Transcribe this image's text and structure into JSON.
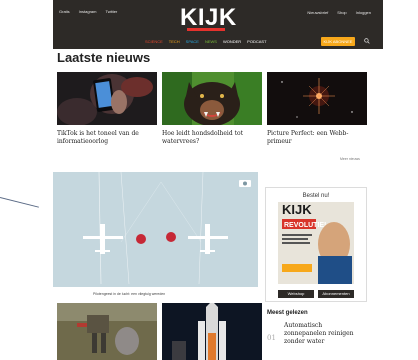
{
  "header": {
    "top_links": [
      "Gratis",
      "Instagram",
      "Twitter"
    ],
    "logo": "KIJK",
    "right_links": [
      "Nieuwsbrief",
      "Shop",
      "Inloggen"
    ],
    "nav": [
      {
        "label": "SCIENCE",
        "color": "#e4472b"
      },
      {
        "label": "TECH",
        "color": "#f7a81b"
      },
      {
        "label": "SPACE",
        "color": "#27a8e0"
      },
      {
        "label": "NEWS",
        "color": "#7bbf3a"
      },
      {
        "label": "WONDER",
        "color": "#ffffff"
      },
      {
        "label": "PODCAST",
        "color": "#ffffff"
      }
    ],
    "subscribe_label": "KIJK ABONNEE",
    "accent": "#f7a81b"
  },
  "latest": {
    "title": "Laatste nieuws",
    "cards": [
      {
        "title": "TikTok is het toneel van de informatieoorlog"
      },
      {
        "title": "Hoe leidt hondsdolheid tot watervrees?"
      },
      {
        "title": "Picture Perfect: een Webb-primeur"
      }
    ],
    "more_label": "Meer nieuws"
  },
  "feature": {
    "caption": "Pilotengeest in de lucht: een vliegtuig wereden"
  },
  "magazine": {
    "heading": "Bestel nu!",
    "cover_logo": "KIJK",
    "cover_headline": "REVOLUTIE!",
    "webshop_label": "Webshop",
    "subscribe_label": "Abonnementen"
  },
  "most_read": {
    "title": "Meest gelezen",
    "items": [
      {
        "number": "01",
        "text": "Automatisch zonnepanelen reinigen zonder water"
      }
    ]
  }
}
